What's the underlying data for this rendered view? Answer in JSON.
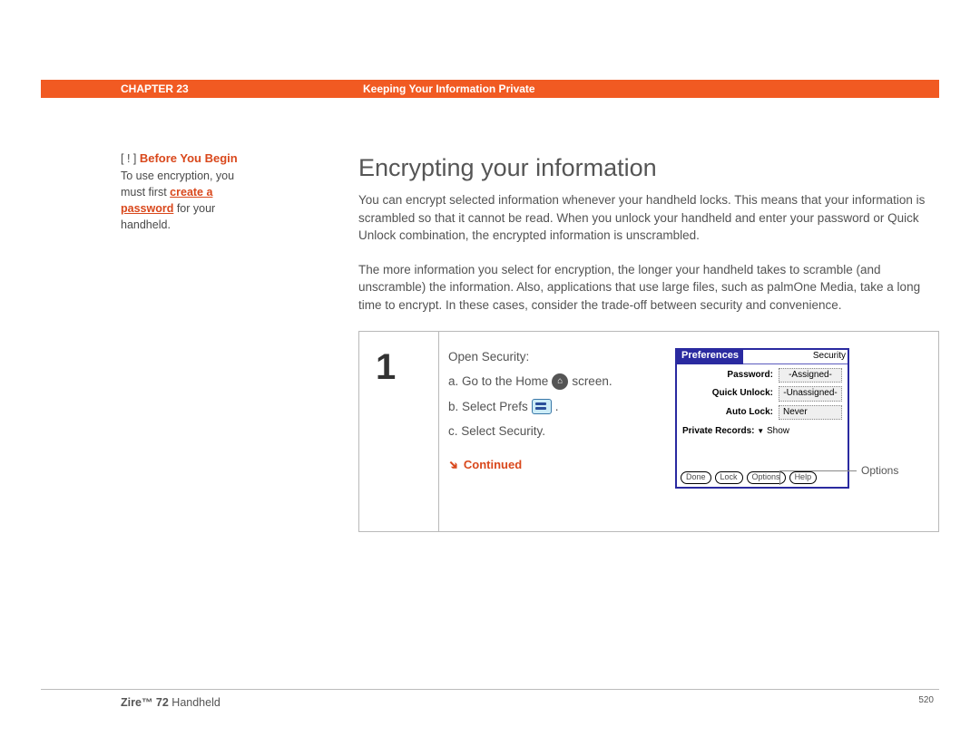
{
  "header": {
    "chapter_label": "CHAPTER 23",
    "chapter_title": "Keeping Your Information Private"
  },
  "sidebar": {
    "marker": "[ ! ]",
    "heading": "Before You Begin",
    "text_before_link": "To use encryption, you must first ",
    "link_text": "create a password",
    "text_after_link": " for your handheld."
  },
  "main": {
    "title": "Encrypting your information",
    "para1": "You can encrypt selected information whenever your handheld locks. This means that your information is scrambled so that it cannot be read. When you unlock your handheld and enter your password or Quick Unlock combination, the encrypted information is unscrambled.",
    "para2": "The more information you select for encryption, the longer your handheld takes to scramble (and unscramble) the information. Also, applications that use large files, such as palmOne Media, take a long time to encrypt. In these cases, consider the trade-off between security and convenience."
  },
  "step": {
    "number": "1",
    "intro": "Open Security:",
    "a_pre": "a.  Go to the Home ",
    "a_post": " screen.",
    "b_pre": "b.  Select Prefs ",
    "b_post": ".",
    "c": "c.  Select Security.",
    "continued": "Continued"
  },
  "device": {
    "prefs": "Preferences",
    "section": "Security",
    "password_lbl": "Password:",
    "password_val": "-Assigned-",
    "quick_lbl": "Quick Unlock:",
    "quick_val": "-Unassigned-",
    "auto_lbl": "Auto Lock:",
    "auto_val": "Never",
    "private_lbl": "Private Records:",
    "private_val": "Show",
    "btn_done": "Done",
    "btn_lock": "Lock",
    "btn_options": "Options",
    "btn_help": "Help"
  },
  "callout": {
    "options": "Options"
  },
  "footer": {
    "product_bold": "Zire™ 72",
    "product_rest": " Handheld",
    "page": "520"
  }
}
